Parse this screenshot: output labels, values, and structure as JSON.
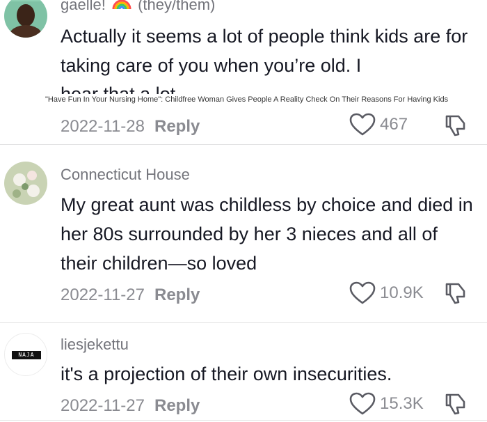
{
  "comments": [
    {
      "username": "gaelle!",
      "pronouns": "(they/them)",
      "text": "Actually it seems a lot of people think kids are for taking care of you when you’re old. I",
      "cut_line": "hear that a lot",
      "date": "2022-11-28",
      "reply_label": "Reply",
      "likes": "467",
      "avatar_icon": "profile-photo"
    },
    {
      "username": "Connecticut House",
      "text": "My great aunt was childless by choice and died in her 80s surrounded by her 3 nieces and all of their children—so loved",
      "date": "2022-11-27",
      "reply_label": "Reply",
      "likes": "10.9K",
      "avatar_icon": "flower-photo"
    },
    {
      "username": "liesjekettu",
      "text": "it's a projection of their own insecurities.",
      "date": "2022-11-27",
      "reply_label": "Reply",
      "likes": "15.3K",
      "avatar_logo_text": "NAJA"
    }
  ],
  "watermark": "\"Have Fun In Your Nursing Home\": Childfree Woman Gives People A Reality Check On Their Reasons For Having Kids",
  "icons": {
    "like": "heart-outline-icon",
    "dislike": "thumbs-down-icon",
    "badge": "rainbow-icon"
  },
  "colors": {
    "text": "#161823",
    "muted": "#8a8b91",
    "divider": "#e3e3e4"
  }
}
